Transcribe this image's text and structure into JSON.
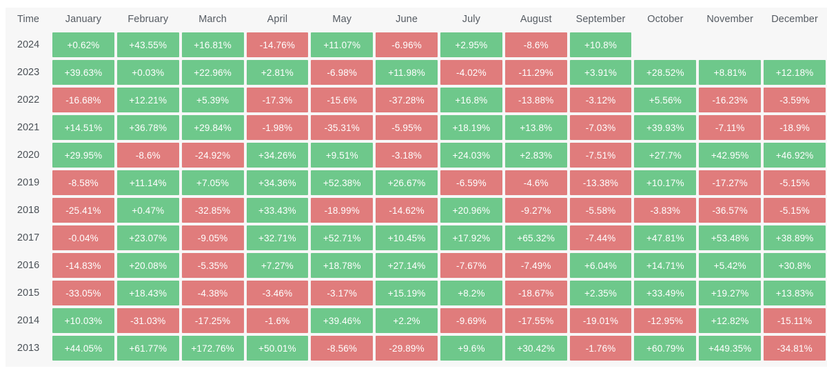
{
  "table": {
    "time_header": "Time",
    "months": [
      "January",
      "February",
      "March",
      "April",
      "May",
      "June",
      "July",
      "August",
      "September",
      "October",
      "November",
      "December"
    ],
    "colors": {
      "positive": "#6ec88b",
      "negative": "#e07c7c",
      "surface": "#f7f7f7",
      "header_text": "#555b62",
      "cell_text": "#ffffff"
    },
    "years": [
      "2024",
      "2023",
      "2022",
      "2021",
      "2020",
      "2019",
      "2018",
      "2017",
      "2016",
      "2015",
      "2014",
      "2013"
    ]
  },
  "chart_data": {
    "type": "heatmap",
    "title": "",
    "xlabel": "",
    "ylabel": "Time",
    "categories": [
      "January",
      "February",
      "March",
      "April",
      "May",
      "June",
      "July",
      "August",
      "September",
      "October",
      "November",
      "December"
    ],
    "rows": [
      "2024",
      "2023",
      "2022",
      "2021",
      "2020",
      "2019",
      "2018",
      "2017",
      "2016",
      "2015",
      "2014",
      "2013"
    ],
    "unit": "%",
    "legend": "green = positive return, red = negative return",
    "values": [
      [
        0.62,
        43.55,
        16.81,
        -14.76,
        11.07,
        -6.96,
        2.95,
        -8.6,
        10.8,
        null,
        null,
        null
      ],
      [
        39.63,
        0.03,
        22.96,
        2.81,
        -6.98,
        11.98,
        -4.02,
        -11.29,
        3.91,
        28.52,
        8.81,
        12.18
      ],
      [
        -16.68,
        12.21,
        5.39,
        -17.3,
        -15.6,
        -37.28,
        16.8,
        -13.88,
        -3.12,
        5.56,
        -16.23,
        -3.59
      ],
      [
        14.51,
        36.78,
        29.84,
        -1.98,
        -35.31,
        -5.95,
        18.19,
        13.8,
        -7.03,
        39.93,
        -7.11,
        -18.9
      ],
      [
        29.95,
        -8.6,
        -24.92,
        34.26,
        9.51,
        -3.18,
        24.03,
        2.83,
        -7.51,
        27.7,
        42.95,
        46.92
      ],
      [
        -8.58,
        11.14,
        7.05,
        34.36,
        52.38,
        26.67,
        -6.59,
        -4.6,
        -13.38,
        10.17,
        -17.27,
        -5.15
      ],
      [
        -25.41,
        0.47,
        -32.85,
        33.43,
        -18.99,
        -14.62,
        20.96,
        -9.27,
        -5.58,
        -3.83,
        -36.57,
        -5.15
      ],
      [
        -0.04,
        23.07,
        -9.05,
        32.71,
        52.71,
        10.45,
        17.92,
        65.32,
        -7.44,
        47.81,
        53.48,
        38.89
      ],
      [
        -14.83,
        20.08,
        -5.35,
        7.27,
        18.78,
        27.14,
        -7.67,
        -7.49,
        6.04,
        14.71,
        5.42,
        30.8
      ],
      [
        -33.05,
        18.43,
        -4.38,
        -3.46,
        -3.17,
        15.19,
        8.2,
        -18.67,
        2.35,
        33.49,
        19.27,
        13.83
      ],
      [
        10.03,
        -31.03,
        -17.25,
        -1.6,
        39.46,
        2.2,
        -9.69,
        -17.55,
        -19.01,
        -12.95,
        12.82,
        -15.11
      ],
      [
        44.05,
        61.77,
        172.76,
        50.01,
        -8.56,
        -29.89,
        9.6,
        30.42,
        -1.76,
        60.79,
        449.35,
        -34.81
      ]
    ],
    "labels": [
      [
        "+0.62%",
        "+43.55%",
        "+16.81%",
        "-14.76%",
        "+11.07%",
        "-6.96%",
        "+2.95%",
        "-8.6%",
        "+10.8%",
        "",
        "",
        ""
      ],
      [
        "+39.63%",
        "+0.03%",
        "+22.96%",
        "+2.81%",
        "-6.98%",
        "+11.98%",
        "-4.02%",
        "-11.29%",
        "+3.91%",
        "+28.52%",
        "+8.81%",
        "+12.18%"
      ],
      [
        "-16.68%",
        "+12.21%",
        "+5.39%",
        "-17.3%",
        "-15.6%",
        "-37.28%",
        "+16.8%",
        "-13.88%",
        "-3.12%",
        "+5.56%",
        "-16.23%",
        "-3.59%"
      ],
      [
        "+14.51%",
        "+36.78%",
        "+29.84%",
        "-1.98%",
        "-35.31%",
        "-5.95%",
        "+18.19%",
        "+13.8%",
        "-7.03%",
        "+39.93%",
        "-7.11%",
        "-18.9%"
      ],
      [
        "+29.95%",
        "-8.6%",
        "-24.92%",
        "+34.26%",
        "+9.51%",
        "-3.18%",
        "+24.03%",
        "+2.83%",
        "-7.51%",
        "+27.7%",
        "+42.95%",
        "+46.92%"
      ],
      [
        "-8.58%",
        "+11.14%",
        "+7.05%",
        "+34.36%",
        "+52.38%",
        "+26.67%",
        "-6.59%",
        "-4.6%",
        "-13.38%",
        "+10.17%",
        "-17.27%",
        "-5.15%"
      ],
      [
        "-25.41%",
        "+0.47%",
        "-32.85%",
        "+33.43%",
        "-18.99%",
        "-14.62%",
        "+20.96%",
        "-9.27%",
        "-5.58%",
        "-3.83%",
        "-36.57%",
        "-5.15%"
      ],
      [
        "-0.04%",
        "+23.07%",
        "-9.05%",
        "+32.71%",
        "+52.71%",
        "+10.45%",
        "+17.92%",
        "+65.32%",
        "-7.44%",
        "+47.81%",
        "+53.48%",
        "+38.89%"
      ],
      [
        "-14.83%",
        "+20.08%",
        "-5.35%",
        "+7.27%",
        "+18.78%",
        "+27.14%",
        "-7.67%",
        "-7.49%",
        "+6.04%",
        "+14.71%",
        "+5.42%",
        "+30.8%"
      ],
      [
        "-33.05%",
        "+18.43%",
        "-4.38%",
        "-3.46%",
        "-3.17%",
        "+15.19%",
        "+8.2%",
        "-18.67%",
        "+2.35%",
        "+33.49%",
        "+19.27%",
        "+13.83%"
      ],
      [
        "+10.03%",
        "-31.03%",
        "-17.25%",
        "-1.6%",
        "+39.46%",
        "+2.2%",
        "-9.69%",
        "-17.55%",
        "-19.01%",
        "-12.95%",
        "+12.82%",
        "-15.11%"
      ],
      [
        "+44.05%",
        "+61.77%",
        "+172.76%",
        "+50.01%",
        "-8.56%",
        "-29.89%",
        "+9.6%",
        "+30.42%",
        "-1.76%",
        "+60.79%",
        "+449.35%",
        "-34.81%"
      ]
    ]
  }
}
